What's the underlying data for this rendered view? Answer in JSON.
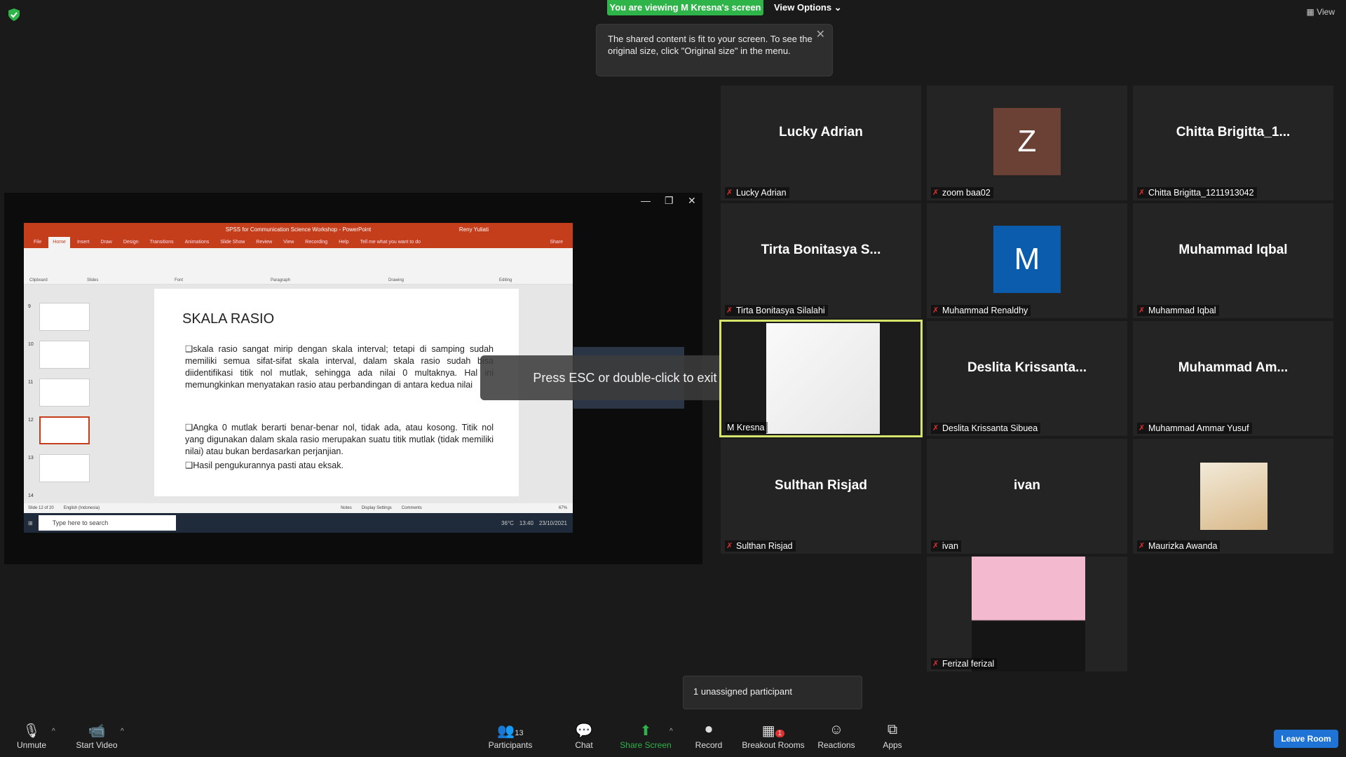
{
  "banner": {
    "viewing": "You are viewing M Kresna's screen",
    "view_options": "View Options",
    "view": "View"
  },
  "tooltip": {
    "text": "The shared content is fit to your screen. To see the original size, click \"Original size\" in the menu."
  },
  "esc_message": "Press ESC or double-click to exit full screen mode",
  "ppt": {
    "title": "SPSS for Communication Science Workshop - PowerPoint",
    "user": "Reny Yuliati",
    "tabs": [
      "File",
      "Home",
      "Insert",
      "Draw",
      "Design",
      "Transitions",
      "Animations",
      "Slide Show",
      "Review",
      "View",
      "Recording",
      "Help",
      "Tell me what you want to do",
      "Share"
    ],
    "groups": [
      "Clipboard",
      "Slides",
      "Font",
      "Paragraph",
      "Drawing",
      "Editing"
    ],
    "thumb_numbers": [
      "9",
      "10",
      "11",
      "12",
      "13",
      "14"
    ],
    "slide_title": "SKALA RASIO",
    "bullets": [
      "skala rasio sangat mirip dengan skala interval; tetapi di samping sudah memiliki semua sifat-sifat skala interval, dalam skala rasio sudah bisa diidentifikasi titik nol mutlak, sehingga ada nilai 0 multaknya. Hal ini memungkinkan menyatakan rasio atau perbandingan di antara kedua nilai",
      "Angka 0 mutlak berarti benar-benar nol, tidak ada, atau kosong. Titik nol yang digunakan dalam skala rasio merupakan suatu titik mutlak (tidak memiliki nilai) atau bukan berdasarkan perjanjian.",
      "Hasil pengukurannya pasti atau eksak."
    ],
    "status": {
      "slide": "Slide 12 of 20",
      "lang": "English (Indonesia)",
      "notes": "Notes",
      "display": "Display Settings",
      "comments": "Comments",
      "zoom": "67%"
    },
    "taskbar": {
      "search": "Type here to search",
      "temp": "36°C",
      "time": "13:40",
      "date": "23/10/2021"
    }
  },
  "participants": [
    {
      "big": "Lucky Adrian",
      "label": "Lucky Adrian"
    },
    {
      "avatar": "Z",
      "avatar_color": "#6b4035",
      "label": "zoom baa02"
    },
    {
      "big": "Chitta Brigitta_1...",
      "label": "Chitta Brigitta_1211913042"
    },
    {
      "big": "Tirta Bonitasya S...",
      "label": "Tirta Bonitasya Silalahi"
    },
    {
      "avatar": "M",
      "avatar_color": "#0b5cad",
      "label": "Muhammad Renaldhy"
    },
    {
      "big": "Muhammad Iqbal",
      "label": "Muhammad Iqbal"
    },
    {
      "label": "M Kresna"
    },
    {
      "big": "Deslita Krissanta...",
      "label": "Deslita Krissanta Sibuea"
    },
    {
      "big": "Muhammad Am...",
      "label": "Muhammad Ammar Yusuf"
    },
    {
      "big": "Sulthan Risjad",
      "label": "Sulthan Risjad"
    },
    {
      "big": "ivan",
      "label": "ivan"
    },
    {
      "label": "Maurizka Awanda"
    },
    {
      "label": "Ferizal ferizal"
    }
  ],
  "unassigned": "1 unassigned participant",
  "toolbar": {
    "unmute": "Unmute",
    "start_video": "Start Video",
    "participants": "Participants",
    "participants_count": "13",
    "chat": "Chat",
    "share_screen": "Share Screen",
    "record": "Record",
    "breakout": "Breakout Rooms",
    "breakout_badge": "1",
    "reactions": "Reactions",
    "apps": "Apps",
    "leave": "Leave Room"
  },
  "colors": {
    "accent_green": "#2fb44a",
    "leave_blue": "#1e73d4",
    "active_speaker": "#d7e46b",
    "ppt_red": "#c43e1c"
  }
}
